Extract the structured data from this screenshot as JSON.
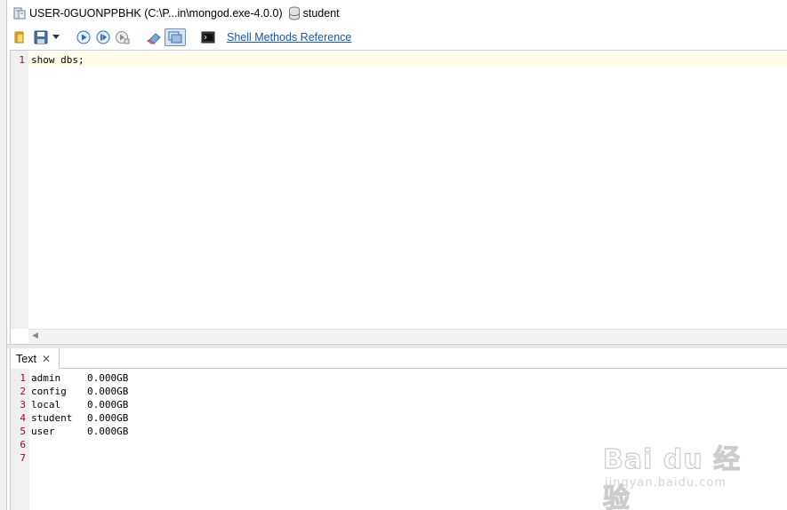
{
  "connection": {
    "server_label": "USER-0GUONPPBHK (C:\\P...in\\mongod.exe-4.0.0)",
    "database_label": "student"
  },
  "toolbar": {
    "shell_link_label": "Shell Methods Reference",
    "icons": [
      "open-folder-icon",
      "save-icon",
      "dropdown-arrow-icon",
      "execute-icon",
      "execute-line-icon",
      "explain-icon",
      "eraser-icon",
      "toggle-view-icon",
      "console-icon"
    ]
  },
  "editor": {
    "line_numbers": [
      "1"
    ],
    "code": "show dbs;"
  },
  "results": {
    "tab_label": "Text",
    "line_numbers": [
      "1",
      "2",
      "3",
      "4",
      "5",
      "6",
      "7"
    ],
    "rows": [
      {
        "name": "admin",
        "size": "0.000GB"
      },
      {
        "name": "config",
        "size": "0.000GB"
      },
      {
        "name": "local",
        "size": "0.000GB"
      },
      {
        "name": "student",
        "size": "0.000GB"
      },
      {
        "name": "user",
        "size": "0.000GB"
      }
    ]
  },
  "watermark": {
    "main": "Bai du 经验",
    "sub": "jingyan.baidu.com"
  }
}
